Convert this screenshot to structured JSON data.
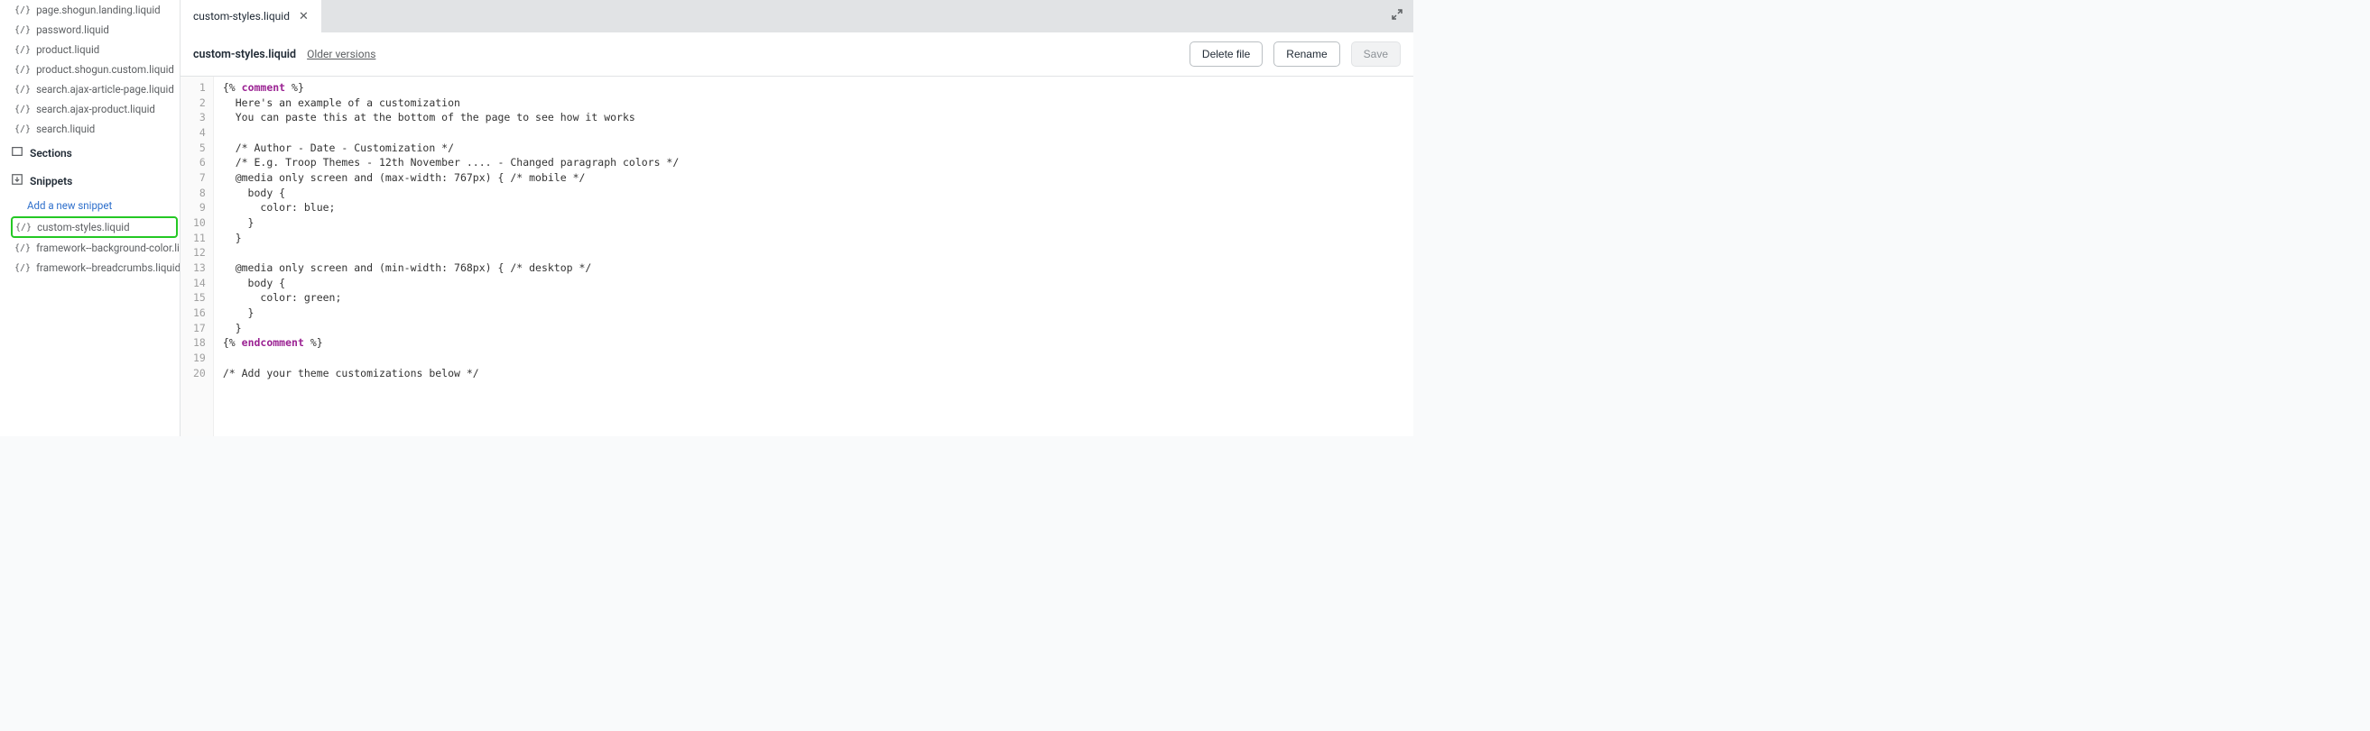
{
  "sidebar": {
    "templates": [
      {
        "name": "page.shogun.landing.liquid"
      },
      {
        "name": "password.liquid"
      },
      {
        "name": "product.liquid"
      },
      {
        "name": "product.shogun.custom.liquid"
      },
      {
        "name": "search.ajax-article-page.liquid"
      },
      {
        "name": "search.ajax-product.liquid"
      },
      {
        "name": "search.liquid"
      }
    ],
    "sections_label": "Sections",
    "snippets_label": "Snippets",
    "add_snippet_label": "Add a new snippet",
    "snippets": [
      {
        "name": "custom-styles.liquid",
        "highlighted": true
      },
      {
        "name": "framework--background-color.liquid"
      },
      {
        "name": "framework--breadcrumbs.liquid"
      }
    ]
  },
  "tab": {
    "label": "custom-styles.liquid"
  },
  "toolbar": {
    "filename": "custom-styles.liquid",
    "older_versions": "Older versions",
    "delete_label": "Delete file",
    "rename_label": "Rename",
    "save_label": "Save"
  },
  "editor": {
    "line_count": 20,
    "code_raw": "{% comment %}\n  Here's an example of a customization\n  You can paste this at the bottom of the page to see how it works\n\n  /* Author - Date - Customization */\n  /* E.g. Troop Themes - 12th November .... - Changed paragraph colors */\n  @media only screen and (max-width: 767px) { /* mobile */\n    body {\n      color: blue;\n    }\n  }\n\n  @media only screen and (min-width: 768px) { /* desktop */\n    body {\n      color: green;\n    }\n  }\n{% endcomment %}\n\n/* Add your theme customizations below */",
    "lines": [
      {
        "n": 1,
        "segs": [
          {
            "t": "{% ",
            "c": ""
          },
          {
            "t": "comment",
            "c": "tok-kw"
          },
          {
            "t": " %}",
            "c": ""
          }
        ]
      },
      {
        "n": 2,
        "segs": [
          {
            "t": "  Here's an example of a customization",
            "c": "tok-cmt"
          }
        ]
      },
      {
        "n": 3,
        "segs": [
          {
            "t": "  You can paste this at the bottom of the page to see how it works",
            "c": "tok-cmt"
          }
        ]
      },
      {
        "n": 4,
        "segs": [
          {
            "t": "",
            "c": ""
          }
        ]
      },
      {
        "n": 5,
        "segs": [
          {
            "t": "  /* Author - Date - Customization */",
            "c": "tok-cmt"
          }
        ]
      },
      {
        "n": 6,
        "segs": [
          {
            "t": "  /* E.g. Troop Themes - 12th November .... - Changed paragraph colors */",
            "c": "tok-cmt"
          }
        ]
      },
      {
        "n": 7,
        "segs": [
          {
            "t": "  @media only screen and (max-width: 767px) { /* mobile */",
            "c": "tok-cmt"
          }
        ]
      },
      {
        "n": 8,
        "segs": [
          {
            "t": "    body {",
            "c": "tok-cmt"
          }
        ]
      },
      {
        "n": 9,
        "segs": [
          {
            "t": "      color: blue;",
            "c": "tok-cmt"
          }
        ]
      },
      {
        "n": 10,
        "segs": [
          {
            "t": "    }",
            "c": "tok-cmt"
          }
        ]
      },
      {
        "n": 11,
        "segs": [
          {
            "t": "  }",
            "c": "tok-cmt"
          }
        ]
      },
      {
        "n": 12,
        "segs": [
          {
            "t": "",
            "c": ""
          }
        ]
      },
      {
        "n": 13,
        "segs": [
          {
            "t": "  @media only screen and (min-width: 768px) { /* desktop */",
            "c": "tok-cmt"
          }
        ]
      },
      {
        "n": 14,
        "segs": [
          {
            "t": "    body {",
            "c": "tok-cmt"
          }
        ]
      },
      {
        "n": 15,
        "segs": [
          {
            "t": "      color: green;",
            "c": "tok-cmt"
          }
        ]
      },
      {
        "n": 16,
        "segs": [
          {
            "t": "    }",
            "c": "tok-cmt"
          }
        ]
      },
      {
        "n": 17,
        "segs": [
          {
            "t": "  }",
            "c": "tok-cmt"
          }
        ]
      },
      {
        "n": 18,
        "segs": [
          {
            "t": "{% ",
            "c": ""
          },
          {
            "t": "endcomment",
            "c": "tok-kw"
          },
          {
            "t": " %}",
            "c": ""
          }
        ]
      },
      {
        "n": 19,
        "segs": [
          {
            "t": "",
            "c": ""
          }
        ]
      },
      {
        "n": 20,
        "segs": [
          {
            "t": "/* Add your theme customizations below */",
            "c": "tok-cmt"
          }
        ]
      }
    ]
  }
}
